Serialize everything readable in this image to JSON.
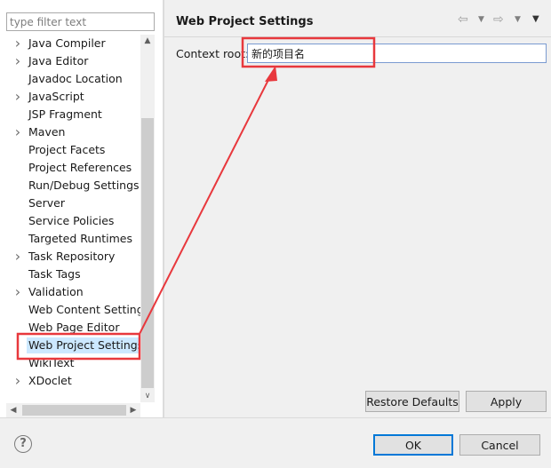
{
  "filter": {
    "placeholder": "type filter text",
    "value": ""
  },
  "tree": {
    "items": [
      {
        "label": "Java Compiler",
        "expandable": true
      },
      {
        "label": "Java Editor",
        "expandable": true
      },
      {
        "label": "Javadoc Location",
        "expandable": false
      },
      {
        "label": "JavaScript",
        "expandable": true
      },
      {
        "label": "JSP Fragment",
        "expandable": false
      },
      {
        "label": "Maven",
        "expandable": true
      },
      {
        "label": "Project Facets",
        "expandable": false
      },
      {
        "label": "Project References",
        "expandable": false
      },
      {
        "label": "Run/Debug Settings",
        "expandable": false
      },
      {
        "label": "Server",
        "expandable": false
      },
      {
        "label": "Service Policies",
        "expandable": false
      },
      {
        "label": "Targeted Runtimes",
        "expandable": false
      },
      {
        "label": "Task Repository",
        "expandable": true
      },
      {
        "label": "Task Tags",
        "expandable": false
      },
      {
        "label": "Validation",
        "expandable": true
      },
      {
        "label": "Web Content Settings",
        "expandable": false
      },
      {
        "label": "Web Page Editor",
        "expandable": false
      },
      {
        "label": "Web Project Settings",
        "expandable": false,
        "selected": true
      },
      {
        "label": "WikiText",
        "expandable": false
      },
      {
        "label": "XDoclet",
        "expandable": true
      }
    ]
  },
  "page": {
    "title": "Web Project Settings",
    "context_root_label": "Context root:",
    "context_root_value": "新的项目名",
    "restore_defaults_label": "Restore Defaults",
    "apply_label": "Apply"
  },
  "footer": {
    "help_symbol": "?",
    "ok_label": "OK",
    "cancel_label": "Cancel"
  },
  "icons": {
    "chevron_right": "chevron-right-icon",
    "back": "back-arrow-icon",
    "forward": "forward-arrow-icon",
    "view_menu": "view-menu-icon",
    "help": "help-icon"
  },
  "colors": {
    "selection": "#cce8ff",
    "annotation_red": "#e8383d",
    "default_button_border": "#0078d7",
    "input_focus_border": "#7a9bd1",
    "panel_background": "#f0f0f0"
  }
}
